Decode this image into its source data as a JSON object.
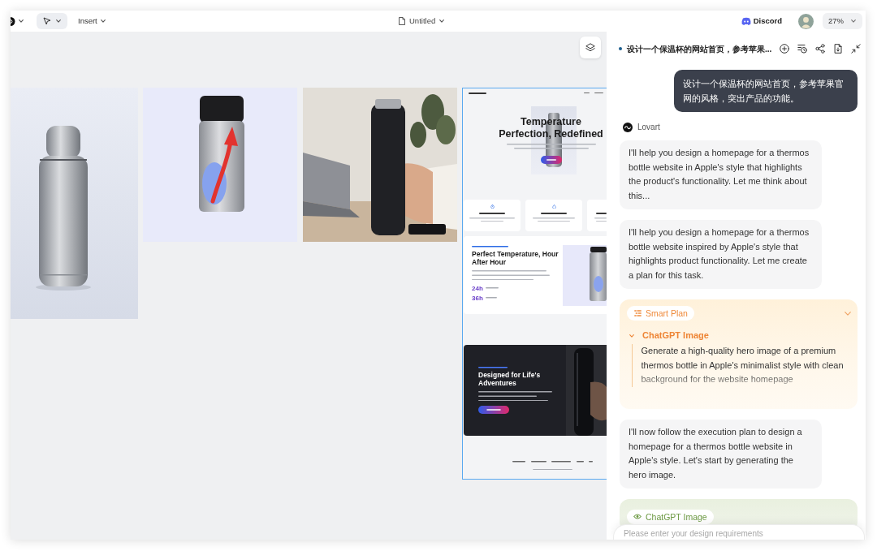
{
  "toolbar": {
    "insert_menu": "Insert",
    "document_title": "Untitled",
    "community_link": "Discord",
    "zoom_level": "27%"
  },
  "canvas": {
    "images": [
      {
        "kind": "product_photo"
      },
      {
        "kind": "feature_graphic"
      },
      {
        "kind": "lifestyle_photo"
      }
    ],
    "webpage": {
      "selected": true,
      "hero": {
        "heading": "Temperature Perfection, Redefined"
      },
      "technology": {
        "heading": "Perfect Temperature, Hour After Hour",
        "stats": [
          "24h",
          "36h"
        ]
      },
      "lifestyle": {
        "heading": "Designed for Life's Adventures"
      }
    }
  },
  "chat": {
    "title": "设计一个保温杯的网站首页，参考苹果...",
    "messages": [
      {
        "kind": "user",
        "text": "设计一个保温杯的网站首页，参考苹果官网的风格，突出产品的功能。"
      },
      {
        "kind": "agent",
        "name": "Lovart"
      },
      {
        "kind": "assistant",
        "text": "I'll help you design a homepage for a thermos bottle website in Apple's style that highlights the product's functionality. Let me think about this..."
      },
      {
        "kind": "assistant",
        "text": "I'll help you design a homepage for a thermos bottle website inspired by Apple's style that highlights product functionality. Let me create a plan for this task."
      },
      {
        "kind": "plan",
        "label": "Smart Plan",
        "steps": [
          {
            "title": "ChatGPT Image",
            "expanded": true,
            "text": "Generate a high-quality hero image of a premium thermos bottle in Apple's minimalist style with clean background for the website homepage"
          }
        ]
      },
      {
        "kind": "assistant",
        "text": "I'll now follow the execution plan to design a homepage for a thermos bottle website in Apple's style. Let's start by generating the hero image."
      },
      {
        "kind": "tool",
        "label": "ChatGPT Image"
      }
    ],
    "input": {
      "placeholder": "Please enter your design requirements"
    }
  }
}
